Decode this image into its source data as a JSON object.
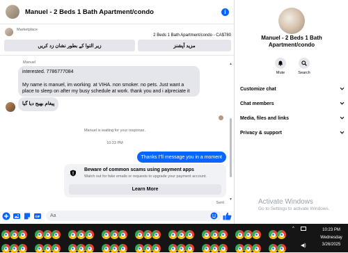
{
  "header": {
    "title": "Manuel - 2 Beds 1 Bath Apartment/condo"
  },
  "listing": {
    "label": "Marketplace",
    "price_line": "2 Beds 1 Bath Apartment/condo - CA$780",
    "prompt_buttons": [
      "زیر التوا کے بطور نشان زد کریں",
      "مزید آپشنز"
    ]
  },
  "messages": {
    "sender_name": "Manuel",
    "incoming_1": "interested. 7786777084\n\nMy name is manuel, im working  at VIHA. non smoker. no pets. Just want a place to sleep on after my busy schedule at work. thank you and i alpreciate it",
    "incoming_2": "پیغام بھیج دیا گیا",
    "status_waiting": "Manuel is waiting for your response.",
    "time_stamp": "10:23 PM",
    "outgoing_1": "Thanks I\"ll message you in a moment",
    "warning_title": "Beware of common scams using payment apps",
    "warning_subtitle": "Watch out for fake emails or requests to upgrade your payment account.",
    "warning_button": "Learn More",
    "sent_label": "Sent"
  },
  "composer": {
    "placeholder": "Aa"
  },
  "sidebar": {
    "profile_name": "Manuel - 2 Beds 1 Bath Apartment/condo",
    "actions": [
      {
        "label": "Mute",
        "icon": "bell-icon"
      },
      {
        "label": "Search",
        "icon": "search-icon"
      }
    ],
    "sections": [
      "Customize chat",
      "Chat members",
      "Media, files and links",
      "Privacy & support"
    ]
  },
  "watermark": {
    "line1": "Activate Windows",
    "line2": "Go to Settings to activate Windows."
  },
  "taskbar": {
    "icon": "chrome-icon",
    "time": "10:23 PM",
    "day": "Wednesday",
    "date": "3/26/2025"
  },
  "colors": {
    "accent": "#0866ff",
    "bubble_in": "#e4e6eb",
    "taskbar": "#151515"
  }
}
